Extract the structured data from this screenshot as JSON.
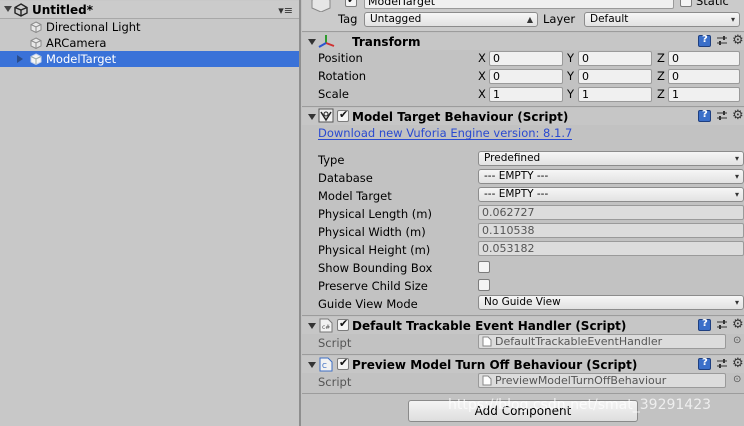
{
  "hierarchy": {
    "scene_title": "Untitled*",
    "items": [
      {
        "label": "Directional Light"
      },
      {
        "label": "ARCamera"
      },
      {
        "label": "ModelTarget"
      }
    ]
  },
  "inspector": {
    "header": {
      "object_name": "ModelTarget",
      "static_label": "Static",
      "tag_label": "Tag",
      "tag_value": "Untagged",
      "layer_label": "Layer",
      "layer_value": "Default"
    },
    "transform": {
      "title": "Transform",
      "rows": [
        {
          "label": "Position",
          "x": "0",
          "y": "0",
          "z": "0"
        },
        {
          "label": "Rotation",
          "x": "0",
          "y": "0",
          "z": "0"
        },
        {
          "label": "Scale",
          "x": "1",
          "y": "1",
          "z": "1"
        }
      ],
      "axis_x": "X",
      "axis_y": "Y",
      "axis_z": "Z"
    },
    "model_target": {
      "title": "Model Target Behaviour (Script)",
      "download_link": "Download new Vuforia Engine version: 8.1.7",
      "type_label": "Type",
      "type_value": "Predefined",
      "database_label": "Database",
      "database_value": "--- EMPTY ---",
      "model_target_label": "Model Target",
      "model_target_value": "--- EMPTY ---",
      "length_label": "Physical Length (m)",
      "length_value": "0.062727",
      "width_label": "Physical Width (m)",
      "width_value": "0.110538",
      "height_label": "Physical Height (m)",
      "height_value": "0.053182",
      "bounding_label": "Show Bounding Box",
      "preserve_label": "Preserve Child Size",
      "guide_label": "Guide View Mode",
      "guide_value": "No Guide View"
    },
    "event_handler": {
      "title": "Default Trackable Event Handler (Script)",
      "script_label": "Script",
      "script_value": "DefaultTrackableEventHandler"
    },
    "preview": {
      "title": "Preview Model Turn Off Behaviour (Script)",
      "script_label": "Script",
      "script_value": "PreviewModelTurnOffBehaviour"
    },
    "add_component": "Add Component"
  },
  "watermark": "https://blog.csdn.net/smat_39291423"
}
